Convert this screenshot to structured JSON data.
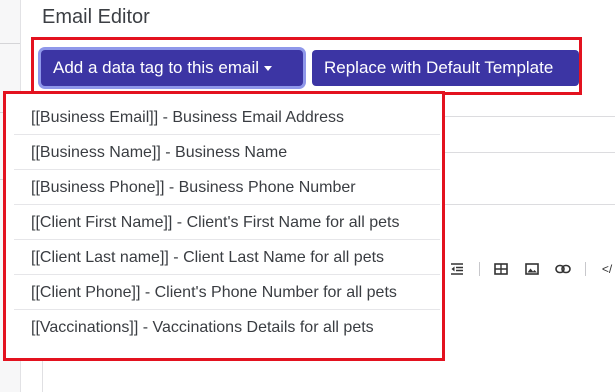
{
  "editor": {
    "title": "Email Editor"
  },
  "buttons": {
    "add_tag_label": "Add a data tag to this email",
    "replace_label": "Replace with Default Template"
  },
  "dropdown": {
    "items": [
      "[[Business Email]] - Business Email Address",
      "[[Business Name]] - Business Name",
      "[[Business Phone]] - Business Phone Number",
      "[[Client First Name]] - Client's First Name for all pets",
      "[[Client Last name]] - Client Last Name for all pets",
      "[[Client Phone]] - Client's Phone Number for all pets",
      "[[Vaccinations]] - Vaccinations Details for all pets"
    ]
  },
  "toolbar": {
    "icons": [
      "outdent-icon",
      "table-icon",
      "image-icon",
      "link-icon",
      "code-view-icon"
    ],
    "code_glyph": "</"
  },
  "colors": {
    "button_bg": "#3c35a4",
    "highlight": "#e3121f",
    "focus_ring": "#8f97ea"
  }
}
